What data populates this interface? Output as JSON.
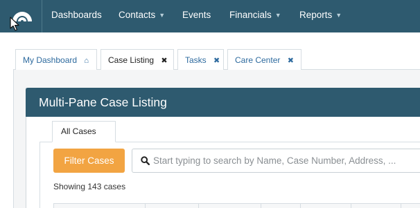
{
  "nav": {
    "items": [
      {
        "label": "Dashboards",
        "has_caret": false
      },
      {
        "label": "Contacts",
        "has_caret": true
      },
      {
        "label": "Events",
        "has_caret": false
      },
      {
        "label": "Financials",
        "has_caret": true
      },
      {
        "label": "Reports",
        "has_caret": true
      }
    ],
    "caret_glyph": "▼"
  },
  "tabs": [
    {
      "label": "My Dashboard",
      "icon": "home-icon"
    },
    {
      "label": "Case Listing",
      "icon": "close-icon",
      "active": true
    },
    {
      "label": "Tasks",
      "icon": "close-icon"
    },
    {
      "label": "Care Center",
      "icon": "close-icon"
    }
  ],
  "icons": {
    "home": "⌂",
    "close": "✖"
  },
  "panel": {
    "title": "Multi-Pane Case Listing",
    "subtab": "All Cases",
    "filter_button": "Filter Cases",
    "search_placeholder": "Start typing to search by Name, Case Number, Address, ...",
    "showing_text": "Showing 143 cases"
  },
  "colors": {
    "navbar": "#2e5a6f",
    "panel_header": "#2e5a6f",
    "filter_button": "#f2a442",
    "tab_link": "#2d6a9e"
  }
}
